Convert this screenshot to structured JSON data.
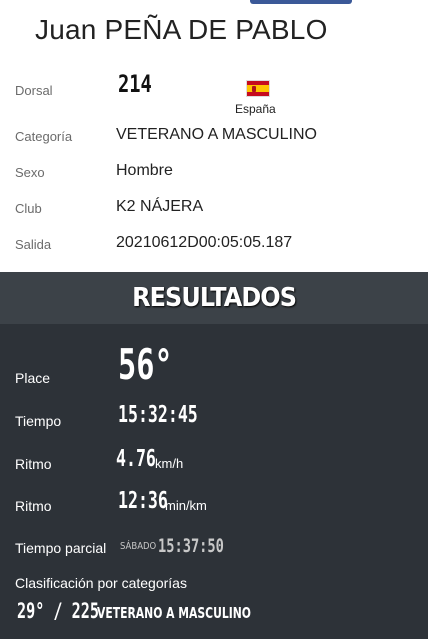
{
  "athlete": {
    "name": "Juan PEÑA DE PABLO"
  },
  "info": {
    "dorsal_label": "Dorsal",
    "dorsal_value": "214",
    "country": "España",
    "flag_icon": "spain-flag-icon",
    "categoria_label": "Categoría",
    "categoria_value": "VETERANO A MASCULINO",
    "sexo_label": "Sexo",
    "sexo_value": "Hombre",
    "club_label": "Club",
    "club_value": "K2 NÁJERA",
    "salida_label": "Salida",
    "salida_value": "20210612D00:05:05.187"
  },
  "results": {
    "title": "RESULTADOS",
    "place_label": "Place",
    "place_value": "56°",
    "tiempo_label": "Tiempo",
    "tiempo_value": "15:32:45",
    "ritmo1_label": "Ritmo",
    "ritmo1_value": "4.76",
    "ritmo1_unit": "km/h",
    "ritmo2_label": "Ritmo",
    "ritmo2_value": "12:36",
    "ritmo2_unit": "min/km",
    "parcial_label": "Tiempo parcial",
    "parcial_day": "SÁBADO",
    "parcial_time": "15:37:50",
    "clasificacion_label": "Clasificación por categorías",
    "clasificacion_rank": "29° / 225",
    "clasificacion_category": "VETERANO A MASCULINO"
  },
  "colors": {
    "header_band": "#3c4248",
    "results_panel": "#2d3238",
    "top_tab": "#3b5998"
  }
}
